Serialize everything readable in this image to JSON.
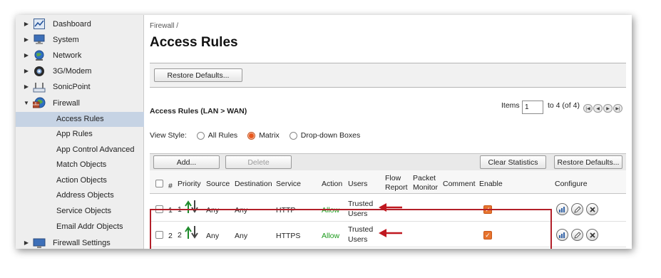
{
  "sidebar": {
    "items": [
      {
        "label": "Dashboard",
        "icon": "dashboard-icon",
        "expanded": false
      },
      {
        "label": "System",
        "icon": "monitor-icon",
        "expanded": false
      },
      {
        "label": "Network",
        "icon": "network-globe-icon",
        "expanded": false
      },
      {
        "label": "3G/Modem",
        "icon": "modem-icon",
        "expanded": false
      },
      {
        "label": "SonicPoint",
        "icon": "access-point-icon",
        "expanded": false
      },
      {
        "label": "Firewall",
        "icon": "firewall-globe-icon",
        "expanded": true
      }
    ],
    "firewall_sub": [
      {
        "label": "Access Rules",
        "active": true
      },
      {
        "label": "App Rules",
        "active": false
      },
      {
        "label": "App Control Advanced",
        "active": false
      },
      {
        "label": "Match Objects",
        "active": false
      },
      {
        "label": "Action Objects",
        "active": false
      },
      {
        "label": "Address Objects",
        "active": false
      },
      {
        "label": "Service Objects",
        "active": false
      },
      {
        "label": "Email Addr Objects",
        "active": false
      }
    ],
    "after": {
      "label": "Firewall Settings",
      "icon": "firewall-settings-icon"
    }
  },
  "main": {
    "breadcrumb": "Firewall /",
    "title": "Access Rules",
    "restore_defaults_top": "Restore Defaults...",
    "section_title": "Access Rules (LAN > WAN)",
    "items_label": "Items",
    "items_value": "1",
    "items_range": "to 4 (of 4)",
    "view_style": {
      "label": "View Style:",
      "options": [
        "All Rules",
        "Matrix",
        "Drop-down Boxes"
      ],
      "selected": "Matrix"
    },
    "toolbar": {
      "add": "Add...",
      "delete": "Delete",
      "clear_statistics": "Clear Statistics",
      "restore_defaults": "Restore Defaults..."
    }
  },
  "table": {
    "headers": {
      "num": "#",
      "priority": "Priority",
      "source": "Source",
      "destination": "Destination",
      "service": "Service",
      "action": "Action",
      "users": "Users",
      "flow_report_1": "Flow",
      "flow_report_2": "Report",
      "packet_monitor_1": "Packet",
      "packet_monitor_2": "Monitor",
      "comment": "Comment",
      "enable": "Enable",
      "configure": "Configure"
    },
    "rows": [
      {
        "num": "1",
        "priority": "1",
        "source": "Any",
        "destination": "Any",
        "service": "HTTP",
        "action": "Allow",
        "users_1": "Trusted",
        "users_2": "Users",
        "enabled": true
      },
      {
        "num": "2",
        "priority": "2",
        "source": "Any",
        "destination": "Any",
        "service": "HTTPS",
        "action": "Allow",
        "users_1": "Trusted",
        "users_2": "Users",
        "enabled": true
      }
    ]
  },
  "colors": {
    "allow": "#1b9a1b",
    "highlight": "#b3202a",
    "active_nav": "#c6d3e4",
    "enable_checkbox": "#e7742e"
  }
}
